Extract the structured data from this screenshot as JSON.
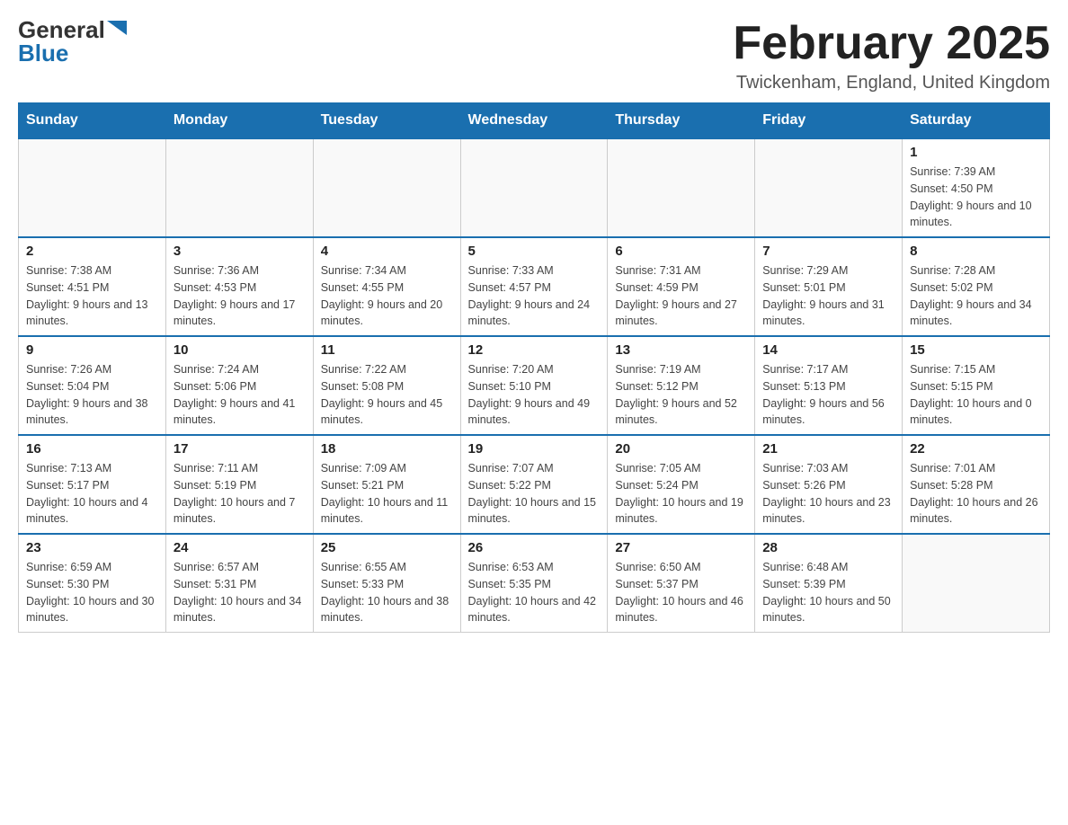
{
  "header": {
    "logo_general": "General",
    "logo_blue": "Blue",
    "month_title": "February 2025",
    "location": "Twickenham, England, United Kingdom"
  },
  "days_of_week": [
    "Sunday",
    "Monday",
    "Tuesday",
    "Wednesday",
    "Thursday",
    "Friday",
    "Saturday"
  ],
  "weeks": [
    {
      "days": [
        {
          "number": "",
          "info": ""
        },
        {
          "number": "",
          "info": ""
        },
        {
          "number": "",
          "info": ""
        },
        {
          "number": "",
          "info": ""
        },
        {
          "number": "",
          "info": ""
        },
        {
          "number": "",
          "info": ""
        },
        {
          "number": "1",
          "info": "Sunrise: 7:39 AM\nSunset: 4:50 PM\nDaylight: 9 hours and 10 minutes."
        }
      ]
    },
    {
      "days": [
        {
          "number": "2",
          "info": "Sunrise: 7:38 AM\nSunset: 4:51 PM\nDaylight: 9 hours and 13 minutes."
        },
        {
          "number": "3",
          "info": "Sunrise: 7:36 AM\nSunset: 4:53 PM\nDaylight: 9 hours and 17 minutes."
        },
        {
          "number": "4",
          "info": "Sunrise: 7:34 AM\nSunset: 4:55 PM\nDaylight: 9 hours and 20 minutes."
        },
        {
          "number": "5",
          "info": "Sunrise: 7:33 AM\nSunset: 4:57 PM\nDaylight: 9 hours and 24 minutes."
        },
        {
          "number": "6",
          "info": "Sunrise: 7:31 AM\nSunset: 4:59 PM\nDaylight: 9 hours and 27 minutes."
        },
        {
          "number": "7",
          "info": "Sunrise: 7:29 AM\nSunset: 5:01 PM\nDaylight: 9 hours and 31 minutes."
        },
        {
          "number": "8",
          "info": "Sunrise: 7:28 AM\nSunset: 5:02 PM\nDaylight: 9 hours and 34 minutes."
        }
      ]
    },
    {
      "days": [
        {
          "number": "9",
          "info": "Sunrise: 7:26 AM\nSunset: 5:04 PM\nDaylight: 9 hours and 38 minutes."
        },
        {
          "number": "10",
          "info": "Sunrise: 7:24 AM\nSunset: 5:06 PM\nDaylight: 9 hours and 41 minutes."
        },
        {
          "number": "11",
          "info": "Sunrise: 7:22 AM\nSunset: 5:08 PM\nDaylight: 9 hours and 45 minutes."
        },
        {
          "number": "12",
          "info": "Sunrise: 7:20 AM\nSunset: 5:10 PM\nDaylight: 9 hours and 49 minutes."
        },
        {
          "number": "13",
          "info": "Sunrise: 7:19 AM\nSunset: 5:12 PM\nDaylight: 9 hours and 52 minutes."
        },
        {
          "number": "14",
          "info": "Sunrise: 7:17 AM\nSunset: 5:13 PM\nDaylight: 9 hours and 56 minutes."
        },
        {
          "number": "15",
          "info": "Sunrise: 7:15 AM\nSunset: 5:15 PM\nDaylight: 10 hours and 0 minutes."
        }
      ]
    },
    {
      "days": [
        {
          "number": "16",
          "info": "Sunrise: 7:13 AM\nSunset: 5:17 PM\nDaylight: 10 hours and 4 minutes."
        },
        {
          "number": "17",
          "info": "Sunrise: 7:11 AM\nSunset: 5:19 PM\nDaylight: 10 hours and 7 minutes."
        },
        {
          "number": "18",
          "info": "Sunrise: 7:09 AM\nSunset: 5:21 PM\nDaylight: 10 hours and 11 minutes."
        },
        {
          "number": "19",
          "info": "Sunrise: 7:07 AM\nSunset: 5:22 PM\nDaylight: 10 hours and 15 minutes."
        },
        {
          "number": "20",
          "info": "Sunrise: 7:05 AM\nSunset: 5:24 PM\nDaylight: 10 hours and 19 minutes."
        },
        {
          "number": "21",
          "info": "Sunrise: 7:03 AM\nSunset: 5:26 PM\nDaylight: 10 hours and 23 minutes."
        },
        {
          "number": "22",
          "info": "Sunrise: 7:01 AM\nSunset: 5:28 PM\nDaylight: 10 hours and 26 minutes."
        }
      ]
    },
    {
      "days": [
        {
          "number": "23",
          "info": "Sunrise: 6:59 AM\nSunset: 5:30 PM\nDaylight: 10 hours and 30 minutes."
        },
        {
          "number": "24",
          "info": "Sunrise: 6:57 AM\nSunset: 5:31 PM\nDaylight: 10 hours and 34 minutes."
        },
        {
          "number": "25",
          "info": "Sunrise: 6:55 AM\nSunset: 5:33 PM\nDaylight: 10 hours and 38 minutes."
        },
        {
          "number": "26",
          "info": "Sunrise: 6:53 AM\nSunset: 5:35 PM\nDaylight: 10 hours and 42 minutes."
        },
        {
          "number": "27",
          "info": "Sunrise: 6:50 AM\nSunset: 5:37 PM\nDaylight: 10 hours and 46 minutes."
        },
        {
          "number": "28",
          "info": "Sunrise: 6:48 AM\nSunset: 5:39 PM\nDaylight: 10 hours and 50 minutes."
        },
        {
          "number": "",
          "info": ""
        }
      ]
    }
  ]
}
